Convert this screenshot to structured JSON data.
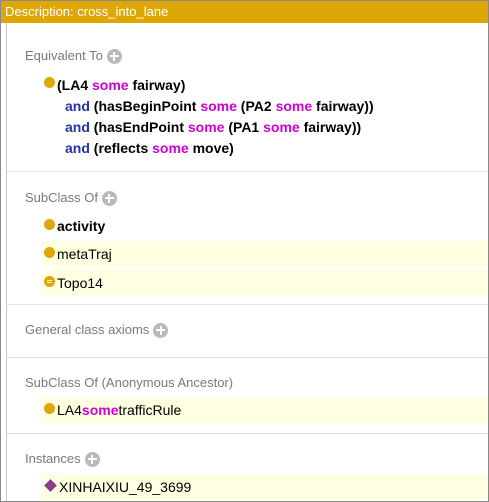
{
  "title": "Description: cross_into_lane",
  "sections": {
    "equivalent_to": {
      "label": "Equivalent To",
      "expression": {
        "line1": {
          "open": "(LA4 ",
          "some": "some",
          "rest": " fairway)"
        },
        "line2": {
          "and": "and",
          "a": " (hasBeginPoint ",
          "some1": "some",
          "b": " (PA2 ",
          "some2": "some",
          "c": " fairway))"
        },
        "line3": {
          "and": "and",
          "a": " (hasEndPoint ",
          "some1": "some",
          "b": " (PA1 ",
          "some2": "some",
          "c": " fairway))"
        },
        "line4": {
          "and": "and",
          "a": " (reflects ",
          "some": "some",
          "b": " move)"
        }
      }
    },
    "subclass_of": {
      "label": "SubClass Of",
      "items": [
        {
          "label": "activity"
        },
        {
          "label": "metaTraj"
        },
        {
          "label": "Topo14"
        }
      ]
    },
    "general_class_axioms": {
      "label": "General class axioms"
    },
    "subclass_of_anonymous": {
      "label": "SubClass Of (Anonymous Ancestor)",
      "item": {
        "a": "LA4 ",
        "some": "some",
        "b": " trafficRule"
      }
    },
    "instances": {
      "label": "Instances",
      "items": [
        {
          "label": "XINHAIXIU_49_3699"
        }
      ]
    }
  },
  "colors": {
    "titlebar": "#dfa705",
    "class_dot": "#dfa705",
    "keyword_some": "#cc00cc",
    "keyword_and": "#2233aa",
    "individual": "#8c3a8c",
    "row_highlight": "#ffffe1"
  },
  "icons": {
    "add": "plus-circle-icon",
    "class": "class-dot-icon",
    "inferred_class": "inferred-class-icon",
    "individual": "individual-diamond-icon"
  }
}
